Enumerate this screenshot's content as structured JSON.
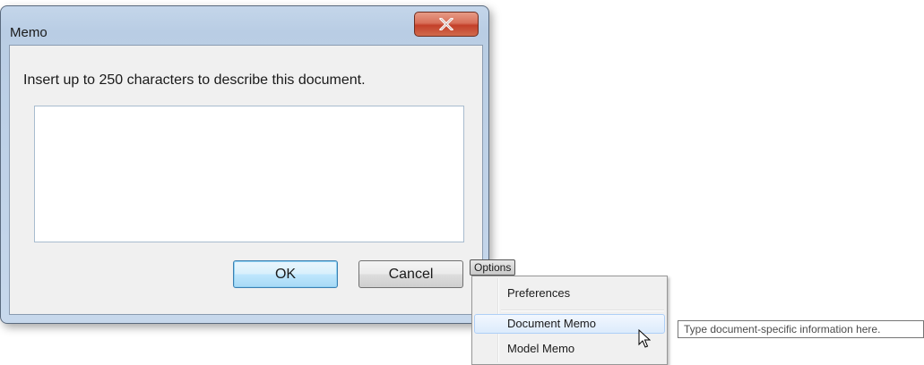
{
  "dialog": {
    "title": "Memo",
    "prompt": "Insert up to 250 characters to describe this document.",
    "memo_value": "",
    "ok_label": "OK",
    "cancel_label": "Cancel"
  },
  "options": {
    "button_label": "Options",
    "menu_items": [
      {
        "label": "Preferences"
      },
      {
        "label": "Document Memo",
        "highlighted": true
      },
      {
        "label": "Model Memo"
      }
    ]
  },
  "tooltip": {
    "text": "Type document-specific information here."
  },
  "icons": {
    "close": "close-icon",
    "cursor": "arrow-cursor-icon"
  },
  "colors": {
    "close_button": "#c4402a",
    "ok_border": "#3c7fb1",
    "menu_highlight": "#dcebfc"
  }
}
